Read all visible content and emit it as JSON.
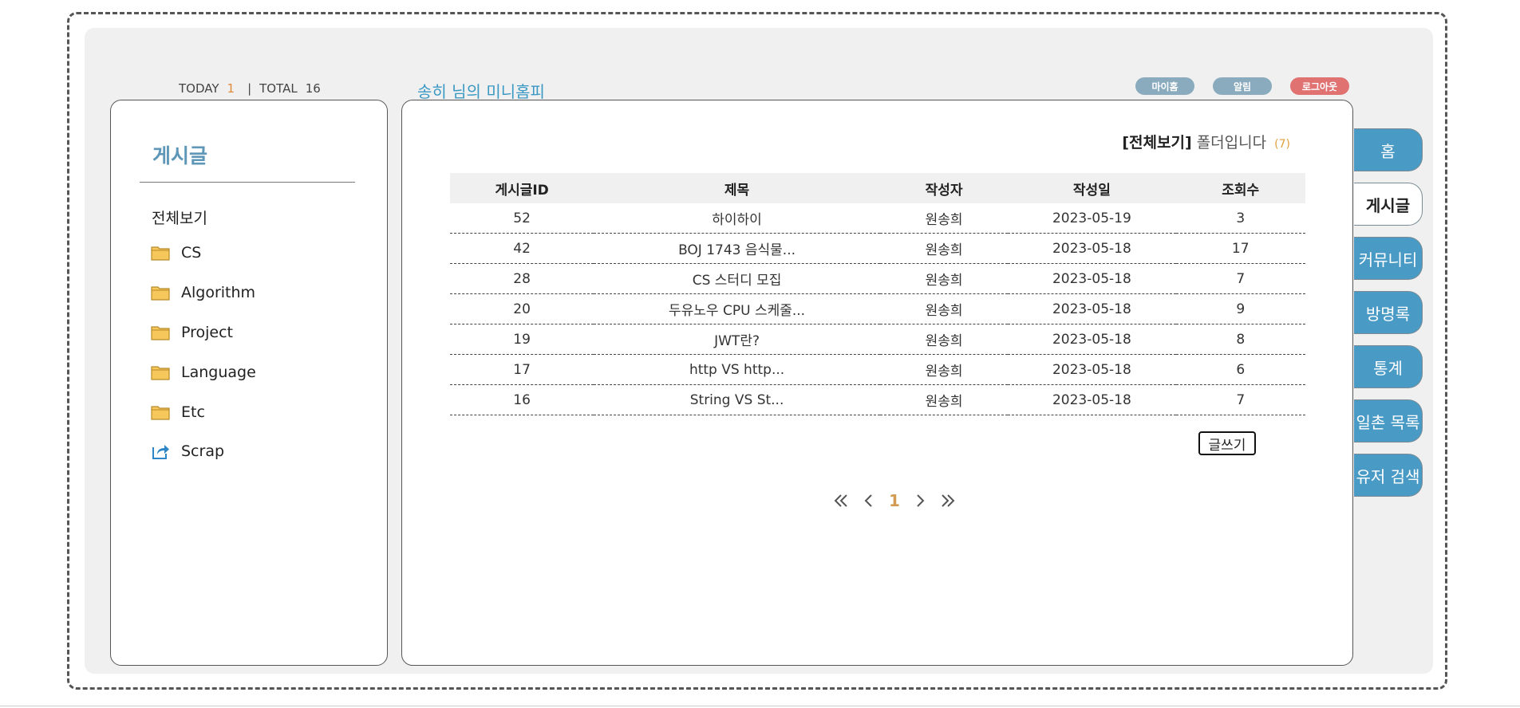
{
  "counter": {
    "today_label": "TODAY",
    "today_value": "1",
    "separator": "|",
    "total_label": "TOTAL",
    "total_value": "16"
  },
  "home_title": "송히 님의 미니홈피",
  "top_buttons": {
    "myhome": {
      "label": "마이홈",
      "color": "#8aabbd"
    },
    "alarm": {
      "label": "알림",
      "color": "#8aabbd"
    },
    "logout": {
      "label": "로그아웃",
      "color": "#e07272"
    }
  },
  "sidebar": {
    "title": "게시글",
    "all_label": "전체보기",
    "categories": [
      {
        "label": "CS",
        "icon": "folder-icon"
      },
      {
        "label": "Algorithm",
        "icon": "folder-icon"
      },
      {
        "label": "Project",
        "icon": "folder-icon"
      },
      {
        "label": "Language",
        "icon": "folder-icon"
      },
      {
        "label": "Etc",
        "icon": "folder-icon"
      },
      {
        "label": "Scrap",
        "icon": "share-icon"
      }
    ]
  },
  "main": {
    "heading_category": "[전체보기]",
    "heading_text": "폴더입니다",
    "heading_count": "(7)",
    "columns": [
      "게시글ID",
      "제목",
      "작성자",
      "작성일",
      "조회수"
    ],
    "rows": [
      [
        "52",
        "하이하이",
        "원송희",
        "2023-05-19",
        "3"
      ],
      [
        "42",
        "BOJ 1743 음식물...",
        "원송희",
        "2023-05-18",
        "17"
      ],
      [
        "28",
        "CS 스터디 모집",
        "원송희",
        "2023-05-18",
        "7"
      ],
      [
        "20",
        "두유노우 CPU 스케줄...",
        "원송희",
        "2023-05-18",
        "9"
      ],
      [
        "19",
        "JWT란?",
        "원송희",
        "2023-05-18",
        "8"
      ],
      [
        "17",
        "http VS http...",
        "원송희",
        "2023-05-18",
        "6"
      ],
      [
        "16",
        "String VS St...",
        "원송희",
        "2023-05-18",
        "7"
      ]
    ],
    "write_button": "글쓰기",
    "pagination": {
      "current": "1"
    }
  },
  "nav_tabs": [
    {
      "label": "홈",
      "active": false
    },
    {
      "label": "게시글",
      "active": true
    },
    {
      "label": "커뮤니티",
      "active": false
    },
    {
      "label": "방명록",
      "active": false
    },
    {
      "label": "통계",
      "active": false
    },
    {
      "label": "일촌 목록",
      "active": false
    },
    {
      "label": "유저 검색",
      "active": false
    }
  ],
  "colors": {
    "accent": "#4a9ac6",
    "title": "#3a98c4",
    "highlight": "#e08a3c"
  }
}
